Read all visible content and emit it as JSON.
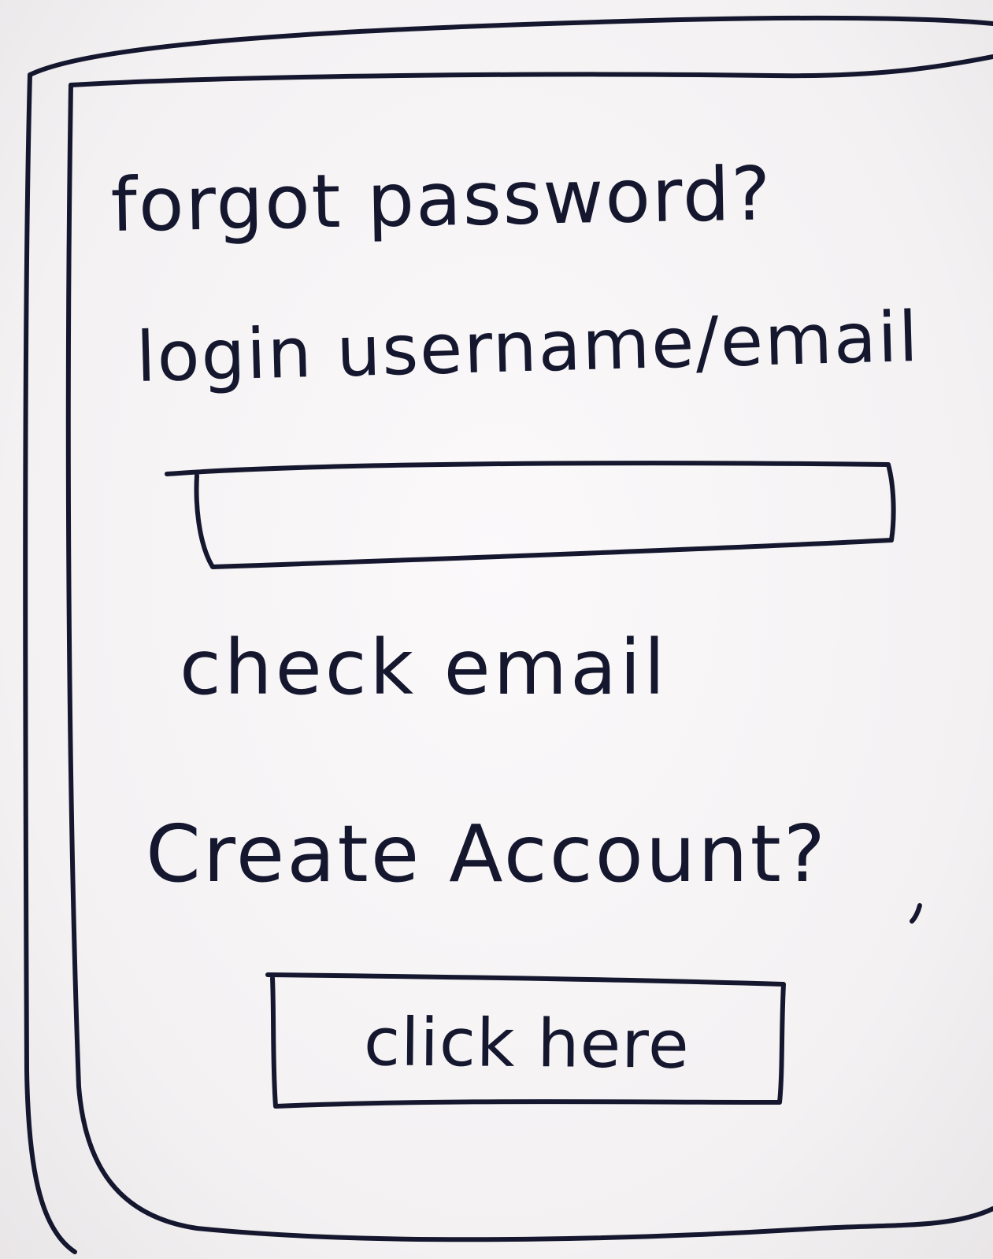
{
  "form": {
    "title": "forgot password?",
    "username_label": "login username/email",
    "username_value": "",
    "status_text": "check email"
  },
  "signup": {
    "prompt": "Create Account?",
    "button_label": "click here"
  },
  "colors": {
    "ink": "#15172f",
    "paper": "#f4f2f3"
  }
}
